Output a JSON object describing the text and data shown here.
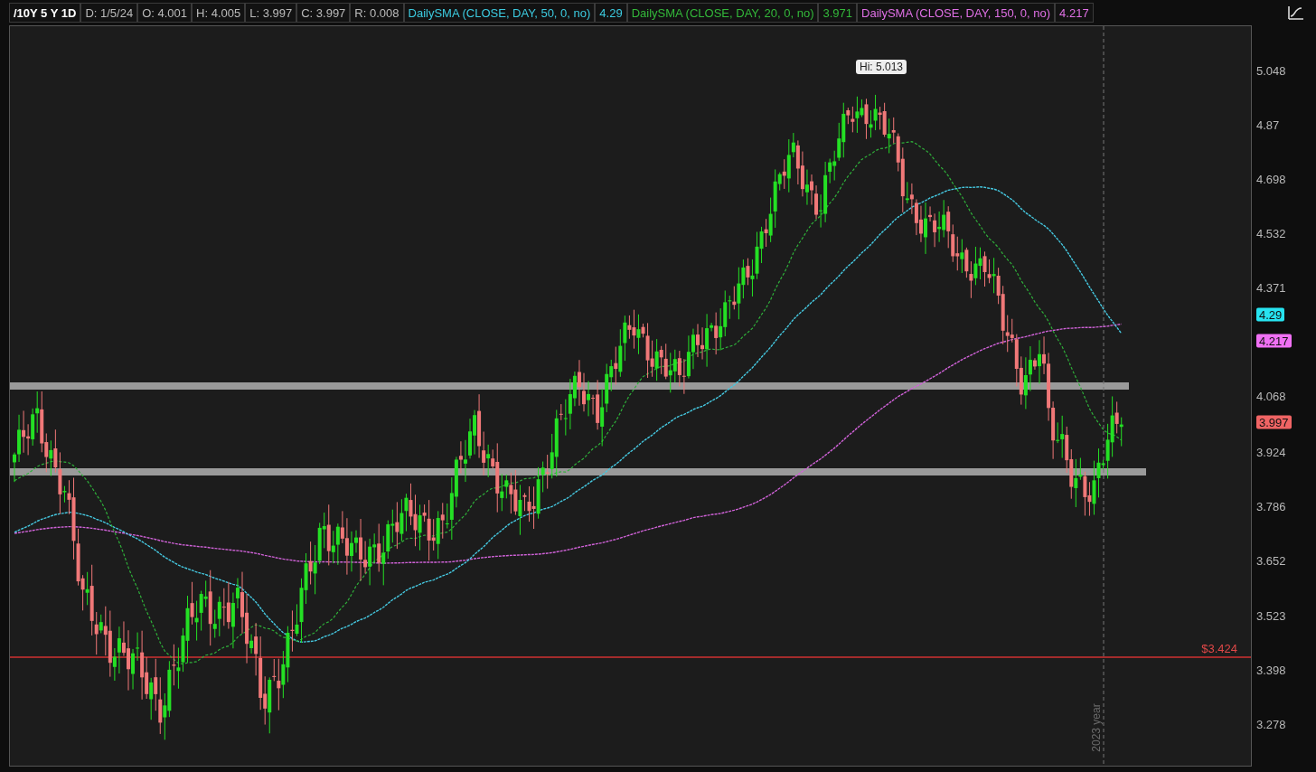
{
  "header": {
    "items": [
      {
        "kind": "symbol",
        "text": "/10Y 5 Y 1D"
      },
      {
        "kind": "field",
        "text": "D: 1/5/24"
      },
      {
        "kind": "field",
        "text": "O: 4.001"
      },
      {
        "kind": "field",
        "text": "H: 4.005"
      },
      {
        "kind": "field",
        "text": "L: 3.997"
      },
      {
        "kind": "field",
        "text": "C: 3.997"
      },
      {
        "kind": "field",
        "text": "R: 0.008"
      },
      {
        "kind": "study",
        "text": "DailySMA (CLOSE, DAY, 50, 0, no)",
        "color": "#3ccbe0"
      },
      {
        "kind": "study",
        "text": "4.29",
        "color": "#3ccbe0"
      },
      {
        "kind": "study",
        "text": "DailySMA (CLOSE, DAY, 20, 0, no)",
        "color": "#33b83a"
      },
      {
        "kind": "study",
        "text": "3.971",
        "color": "#33b83a"
      },
      {
        "kind": "study",
        "text": "DailySMA (CLOSE, DAY, 150, 0, no)",
        "color": "#e070e6"
      },
      {
        "kind": "study",
        "text": "4.217",
        "color": "#e070e6"
      }
    ]
  },
  "chart": {
    "hi_label": "Hi: 5.013",
    "level_line_label": "$3.424",
    "period_label": "2023 year"
  },
  "axis": {
    "labels": [
      {
        "kind": "tick",
        "text": "5.048"
      },
      {
        "kind": "tick",
        "text": "4.87"
      },
      {
        "kind": "tick",
        "text": "4.698"
      },
      {
        "kind": "tick",
        "text": "4.532"
      },
      {
        "kind": "tick",
        "text": "4.371"
      },
      {
        "kind": "tag",
        "text": "4.29",
        "color": "#27e3f0"
      },
      {
        "kind": "tag",
        "text": "4.217",
        "color": "#f070f4"
      },
      {
        "kind": "tick",
        "text": "4.068"
      },
      {
        "kind": "tag",
        "text": "3.997",
        "color": "#f06464"
      },
      {
        "kind": "tick",
        "text": "3.924"
      },
      {
        "kind": "tick",
        "text": "3.786"
      },
      {
        "kind": "tick",
        "text": "3.652"
      },
      {
        "kind": "tick",
        "text": "3.523"
      },
      {
        "kind": "tick",
        "text": "3.398"
      },
      {
        "kind": "tick",
        "text": "3.278"
      }
    ]
  }
}
